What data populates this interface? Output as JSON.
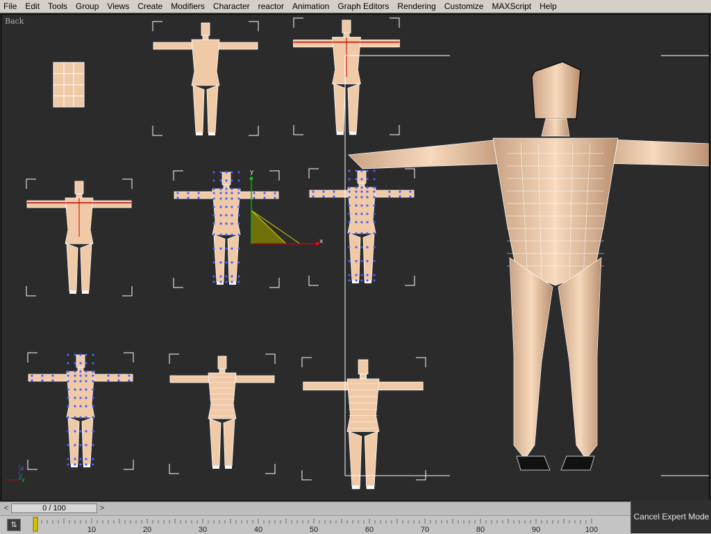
{
  "menu": [
    {
      "label": "File"
    },
    {
      "label": "Edit"
    },
    {
      "label": "Tools"
    },
    {
      "label": "Group"
    },
    {
      "label": "Views"
    },
    {
      "label": "Create"
    },
    {
      "label": "Modifiers"
    },
    {
      "label": "Character"
    },
    {
      "label": "reactor"
    },
    {
      "label": "Animation"
    },
    {
      "label": "Graph Editors"
    },
    {
      "label": "Rendering"
    },
    {
      "label": "Customize"
    },
    {
      "label": "MAXScript"
    },
    {
      "label": "Help"
    }
  ],
  "viewport": {
    "label": "Back",
    "gizmo_axes": {
      "x": "x",
      "y": "y"
    }
  },
  "timeline": {
    "frame_display": "0 / 100",
    "ticks": [
      "10",
      "20",
      "30",
      "40",
      "50",
      "60",
      "70",
      "80",
      "90",
      "100"
    ]
  },
  "buttons": {
    "cancel_expert": "Cancel Expert Mode"
  },
  "colors": {
    "skin": "#f0c9a6",
    "skin_dark": "#9a7558",
    "wire": "#ffffff",
    "viewport_bg": "#2b2b2b",
    "vertex": "#4a5cff",
    "edge_selected": "#cc0000",
    "gizmo_fill": "#8a8a00"
  }
}
